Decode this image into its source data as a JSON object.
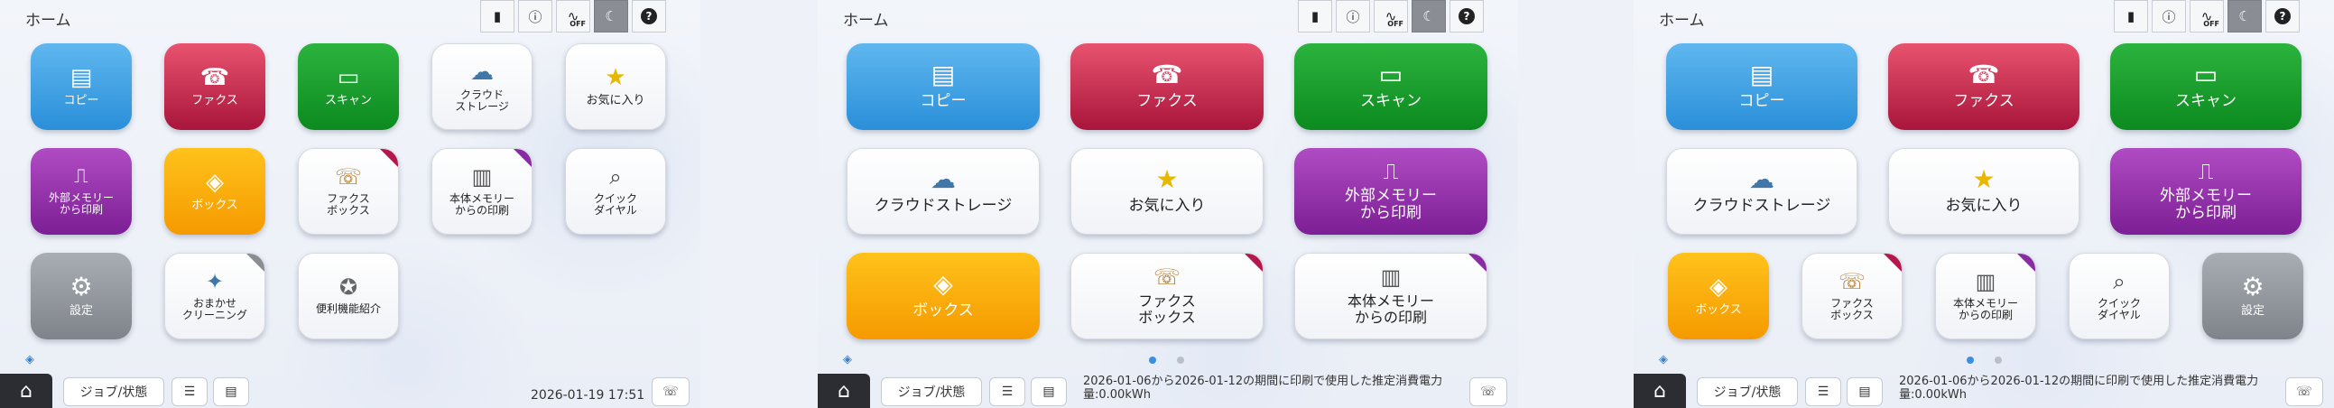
{
  "common": {
    "title": "ホーム",
    "job_status": "ジョブ/状態",
    "energy_note": "2026-01-06から2026-01-12の期間に印刷で使用した推定消費電力\n量:0.00kWh"
  },
  "panel1": {
    "datetime": "2026-01-19 17:51",
    "tiles": [
      {
        "label": "コピー"
      },
      {
        "label": "ファクス"
      },
      {
        "label": "スキャン"
      },
      {
        "label": "クラウド\nストレージ"
      },
      {
        "label": "お気に入り"
      },
      {
        "label": "外部メモリー\nから印刷"
      },
      {
        "label": "ボックス"
      },
      {
        "label": "ファクス\nボックス"
      },
      {
        "label": "本体メモリー\nからの印刷"
      },
      {
        "label": "クイック\nダイヤル"
      },
      {
        "label": "設定"
      },
      {
        "label": "おまかせ\nクリーニング"
      },
      {
        "label": "便利機能紹介"
      }
    ]
  },
  "panel2": {
    "tiles": [
      {
        "label": "コピー"
      },
      {
        "label": "ファクス"
      },
      {
        "label": "スキャン"
      },
      {
        "label": "クラウドストレージ"
      },
      {
        "label": "お気に入り"
      },
      {
        "label": "外部メモリー\nから印刷"
      },
      {
        "label": "ボックス"
      },
      {
        "label": "ファクス\nボックス"
      },
      {
        "label": "本体メモリー\nからの印刷"
      }
    ]
  },
  "panel3": {
    "tiles": [
      {
        "label": "コピー"
      },
      {
        "label": "ファクス"
      },
      {
        "label": "スキャン"
      },
      {
        "label": "クラウドストレージ"
      },
      {
        "label": "お気に入り"
      },
      {
        "label": "外部メモリー\nから印刷"
      },
      {
        "label": "ボックス"
      },
      {
        "label": "ファクス\nボックス"
      },
      {
        "label": "本体メモリー\nからの印刷"
      },
      {
        "label": "クイック\nダイヤル"
      },
      {
        "label": "設定"
      }
    ]
  },
  "colors": {
    "blue": "#2a8fd9",
    "red": "#a9153b",
    "green": "#0c8a1f",
    "purple": "#7c1e95",
    "orange": "#f59a00",
    "gray": "#7f838a"
  }
}
